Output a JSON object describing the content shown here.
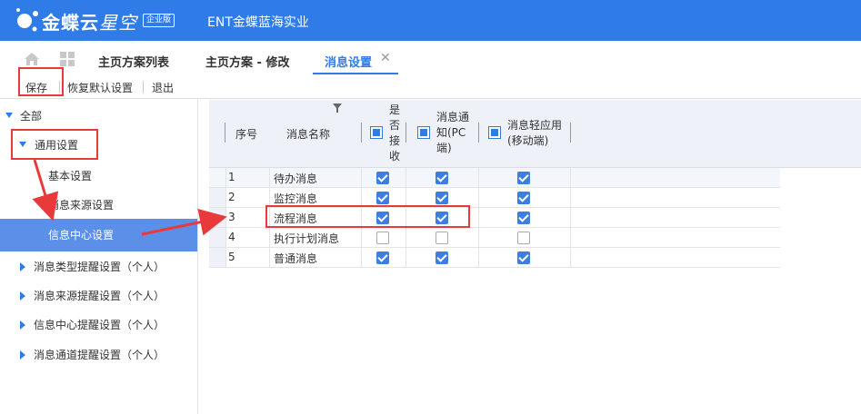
{
  "header": {
    "brand_main": "金蝶云",
    "brand_sub": "星空",
    "badge": "企业版",
    "org": "ENT金蝶蓝海实业"
  },
  "tabs": [
    {
      "label": "主页方案列表"
    },
    {
      "label": "主页方案 - 修改"
    },
    {
      "label": "消息设置",
      "active": true
    }
  ],
  "toolbar": {
    "save": "保存",
    "restore": "恢复默认设置",
    "exit": "退出"
  },
  "tree": {
    "root": "全部",
    "general": "通用设置",
    "basic": "基本设置",
    "source": "消息来源设置",
    "center": "信息中心设置",
    "group_type": "消息类型提醒设置（个人）",
    "group_source": "消息来源提醒设置（个人）",
    "group_center": "信息中心提醒设置（个人）",
    "group_channel": "消息通道提醒设置（个人）"
  },
  "grid": {
    "columns": {
      "seq": "序号",
      "name": "消息名称",
      "receive": [
        "是",
        "否",
        "接",
        "收"
      ],
      "pc": [
        "消息通",
        "知(PC",
        "端)"
      ],
      "mobile": [
        "消息轻应用",
        "(移动端)"
      ]
    },
    "rows": [
      {
        "seq": "1",
        "name": "待办消息",
        "receive": true,
        "pc": true,
        "mobile": true
      },
      {
        "seq": "2",
        "name": "监控消息",
        "receive": true,
        "pc": true,
        "mobile": true
      },
      {
        "seq": "3",
        "name": "流程消息",
        "receive": true,
        "pc": true,
        "mobile": true
      },
      {
        "seq": "4",
        "name": "执行计划消息",
        "receive": false,
        "pc": false,
        "mobile": false
      },
      {
        "seq": "5",
        "name": "普通消息",
        "receive": true,
        "pc": true,
        "mobile": true
      }
    ]
  },
  "colors": {
    "brand": "#2f7be8",
    "annotation": "#e83a3a",
    "selected": "#5b8fe8"
  }
}
